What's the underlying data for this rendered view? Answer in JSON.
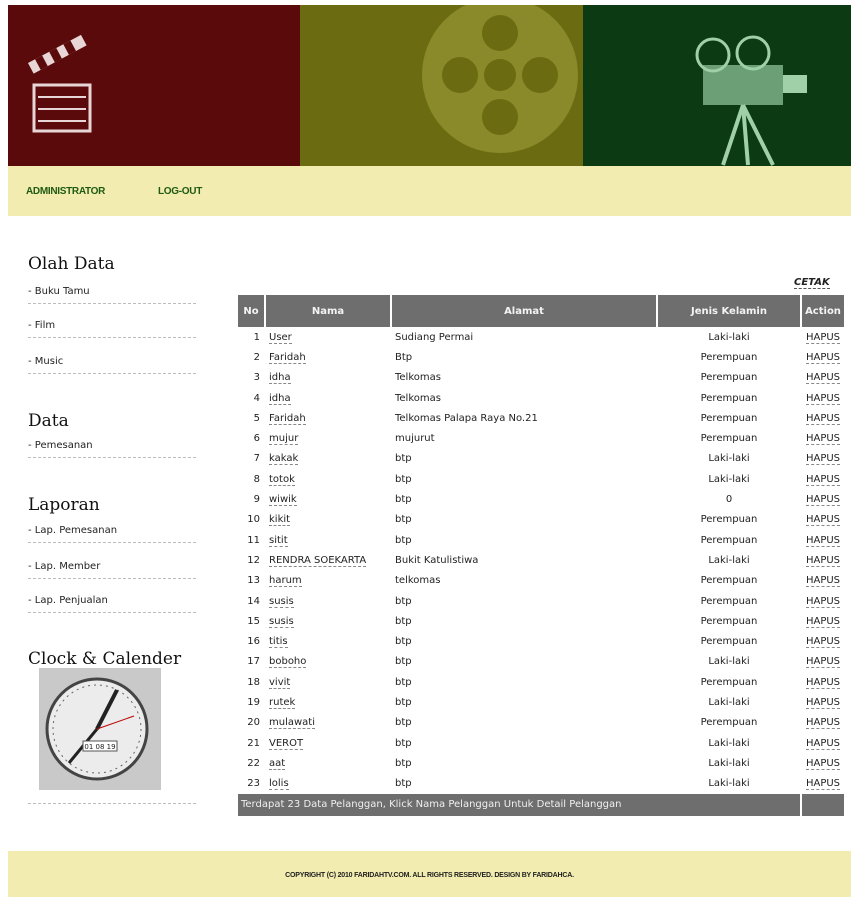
{
  "nav": {
    "admin": "ADMINISTRATOR",
    "logout": "LOG-OUT"
  },
  "sidebar": {
    "olah_data": {
      "title": "Olah Data",
      "items": [
        "- Buku Tamu",
        "- Film",
        "- Music"
      ]
    },
    "data": {
      "title": "Data",
      "items": [
        "- Pemesanan"
      ]
    },
    "laporan": {
      "title": "Laporan",
      "items": [
        "- Lap. Pemesanan",
        "- Lap. Member",
        "- Lap. Penjualan"
      ]
    },
    "clock": {
      "title": "Clock & Calender",
      "date": "01 08 19"
    }
  },
  "table": {
    "cetak": "CETAK",
    "headers": [
      "No",
      "Nama",
      "Alamat",
      "Jenis Kelamin",
      "Action"
    ],
    "rows": [
      [
        "1",
        "User",
        "Sudiang Permai",
        "Laki-laki",
        "HAPUS"
      ],
      [
        "2",
        "Faridah",
        "Btp",
        "Perempuan",
        "HAPUS"
      ],
      [
        "3",
        "idha",
        "Telkomas",
        "Perempuan",
        "HAPUS"
      ],
      [
        "4",
        "idha",
        "Telkomas",
        "Perempuan",
        "HAPUS"
      ],
      [
        "5",
        "Faridah",
        "Telkomas Palapa Raya No.21",
        "Perempuan",
        "HAPUS"
      ],
      [
        "6",
        "mujur",
        "mujurut",
        "Perempuan",
        "HAPUS"
      ],
      [
        "7",
        "kakak",
        "btp",
        "Laki-laki",
        "HAPUS"
      ],
      [
        "8",
        "totok",
        "btp",
        "Laki-laki",
        "HAPUS"
      ],
      [
        "9",
        "wiwik",
        "btp",
        "0",
        "HAPUS"
      ],
      [
        "10",
        "kikit",
        "btp",
        "Perempuan",
        "HAPUS"
      ],
      [
        "11",
        "sitit",
        "btp",
        "Perempuan",
        "HAPUS"
      ],
      [
        "12",
        "RENDRA SOEKARTA",
        "Bukit Katulistiwa",
        "Laki-laki",
        "HAPUS"
      ],
      [
        "13",
        "harum",
        "telkomas",
        "Perempuan",
        "HAPUS"
      ],
      [
        "14",
        "susis",
        "btp",
        "Perempuan",
        "HAPUS"
      ],
      [
        "15",
        "susis",
        "btp",
        "Perempuan",
        "HAPUS"
      ],
      [
        "16",
        "titis",
        "btp",
        "Perempuan",
        "HAPUS"
      ],
      [
        "17",
        "boboho",
        "btp",
        "Laki-laki",
        "HAPUS"
      ],
      [
        "18",
        "vivit",
        "btp",
        "Perempuan",
        "HAPUS"
      ],
      [
        "19",
        "rutek",
        "btp",
        "Laki-laki",
        "HAPUS"
      ],
      [
        "20",
        "mulawati",
        "btp",
        "Perempuan",
        "HAPUS"
      ],
      [
        "21",
        "VEROT",
        "btp",
        "Laki-laki",
        "HAPUS"
      ],
      [
        "22",
        "aat",
        "btp",
        "Laki-laki",
        "HAPUS"
      ],
      [
        "23",
        "lolis",
        "btp",
        "Laki-laki",
        "HAPUS"
      ]
    ],
    "footer_note": "Terdapat 23 Data Pelanggan, Klick Nama Pelanggan Untuk Detail Pelanggan"
  },
  "footer": {
    "copyright": "COPYRIGHT (C) 2010 FARIDAHTV.COM. ALL RIGHTS RESERVED. DESIGN BY FARIDAHCA."
  },
  "colors": {
    "banner_red": "#5a0a0a",
    "banner_yellow": "#6b6b12",
    "banner_green": "#0c3a12",
    "bar_bg": "#f2ecb0",
    "header_cell": "#6e6e6e",
    "nav_text": "#1f5a12"
  }
}
